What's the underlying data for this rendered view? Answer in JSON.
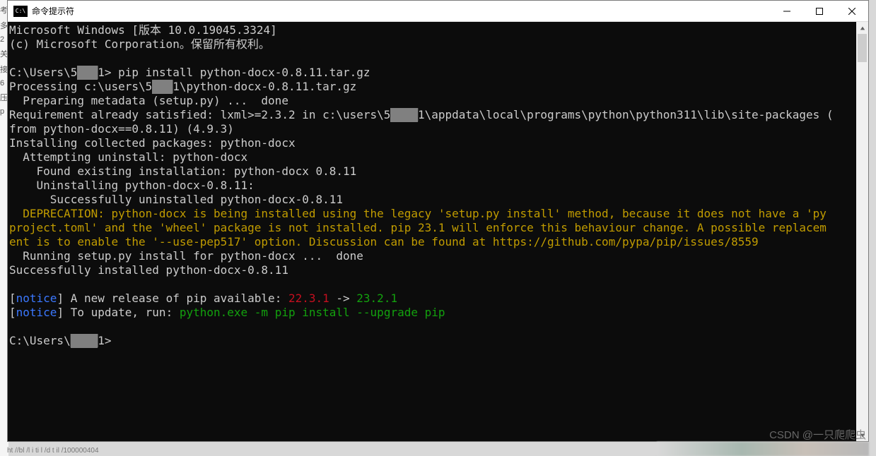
{
  "window": {
    "title": "命令提示符"
  },
  "console": {
    "header1_a": "Microsoft Windows [版本 ",
    "version": "10.0.19045.3324",
    "header1_b": "]",
    "header2": "(c) Microsoft Corporation。保留所有权利。",
    "prompt1_a": "C:\\Users\\5",
    "prompt1_b": "1> ",
    "cmd1": "pip install python-docx-0.8.11.tar.gz",
    "l_processing_a": "Processing c:\\users\\5",
    "l_processing_b": "1\\python-docx-0.8.11.tar.gz",
    "l_preparing": "  Preparing metadata (setup.py) ...  done",
    "l_req_a": "Requirement already satisfied: lxml>=2.3.2 in c:\\users\\5",
    "l_req_b": "1\\appdata\\local\\programs\\python\\python311\\lib\\site-packages (",
    "l_from": "from python-docx==0.8.11) (4.9.3)",
    "l_installing": "Installing collected packages: python-docx",
    "l_attempt": "  Attempting uninstall: python-docx",
    "l_found": "    Found existing installation: python-docx 0.8.11",
    "l_uninst": "    Uninstalling python-docx-0.8.11:",
    "l_success_un": "      Successfully uninstalled python-docx-0.8.11",
    "dep1": "  DEPRECATION: python-docx is being installed using the legacy 'setup.py install' method, because it does not have a 'py",
    "dep2": "project.toml' and the 'wheel' package is not installed. pip 23.1 will enforce this behaviour change. A possible replacem",
    "dep3": "ent is to enable the '--use-pep517' option. Discussion can be found at https://github.com/pypa/pip/issues/8559",
    "l_running": "  Running setup.py install for python-docx ...  done",
    "l_success": "Successfully installed python-docx-0.8.11",
    "notice_label": "notice",
    "notice1_text": "] A new release of pip available: ",
    "notice1_oldver": "22.3.1",
    "notice1_arrow": " -> ",
    "notice1_newver": "23.2.1",
    "notice2_text": "] To update, run: ",
    "notice2_cmd": "python.exe -m pip install --upgrade pip",
    "prompt2_a": "C:\\Users\\",
    "prompt2_b": "1>",
    "redacted_short": "███",
    "redacted_med": "████"
  },
  "watermark": "CSDN @一只爬爬虫",
  "bottom_text": "ht   //bl       /l      i  ti l /d t il /100000404"
}
